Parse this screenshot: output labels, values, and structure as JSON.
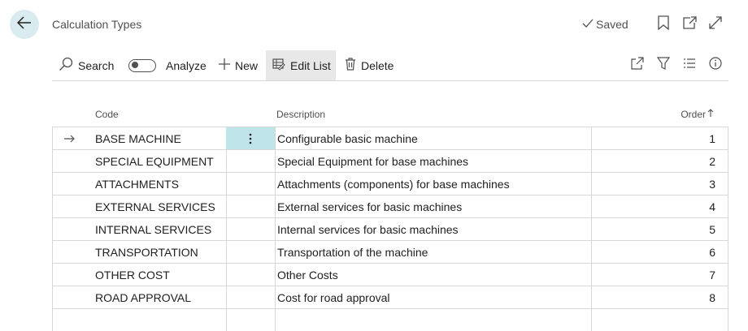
{
  "header": {
    "title": "Calculation Types",
    "saved_label": "Saved"
  },
  "toolbar": {
    "search_label": "Search",
    "analyze_label": "Analyze",
    "new_label": "New",
    "edit_list_label": "Edit List",
    "delete_label": "Delete"
  },
  "table": {
    "columns": {
      "code": "Code",
      "description": "Description",
      "order": "Order"
    },
    "rows": [
      {
        "code": "BASE MACHINE",
        "description": "Configurable basic machine",
        "order": "1"
      },
      {
        "code": "SPECIAL EQUIPMENT",
        "description": "Special Equipment for base machines",
        "order": "2"
      },
      {
        "code": "ATTACHMENTS",
        "description": "Attachments (components) for base machines",
        "order": "3"
      },
      {
        "code": "EXTERNAL SERVICES",
        "description": "External services for basic machines",
        "order": "4"
      },
      {
        "code": "INTERNAL SERVICES",
        "description": "Internal services for basic machines",
        "order": "5"
      },
      {
        "code": "TRANSPORTATION",
        "description": "Transportation of the machine",
        "order": "6"
      },
      {
        "code": "OTHER COST",
        "description": "Other Costs",
        "order": "7"
      },
      {
        "code": "ROAD APPROVAL",
        "description": "Cost for road approval",
        "order": "8"
      }
    ]
  },
  "icons": {
    "back": "back-arrow-icon",
    "bookmark": "bookmark-icon",
    "open_new_window": "open-in-new-window-icon",
    "expand": "expand-icon",
    "search": "search-icon",
    "new": "plus-icon",
    "edit_list": "edit-list-icon",
    "delete": "trash-icon",
    "share": "share-icon",
    "filter": "filter-icon",
    "list": "list-icon",
    "info": "info-icon",
    "row_selected": "row-arrow-icon",
    "row_menu": "more-vertical-icon",
    "sort": "sort-ascending-icon"
  },
  "colors": {
    "accent_light": "#d9ebee",
    "selected_cell": "#bfe4ea",
    "border": "#d6d6d6"
  }
}
